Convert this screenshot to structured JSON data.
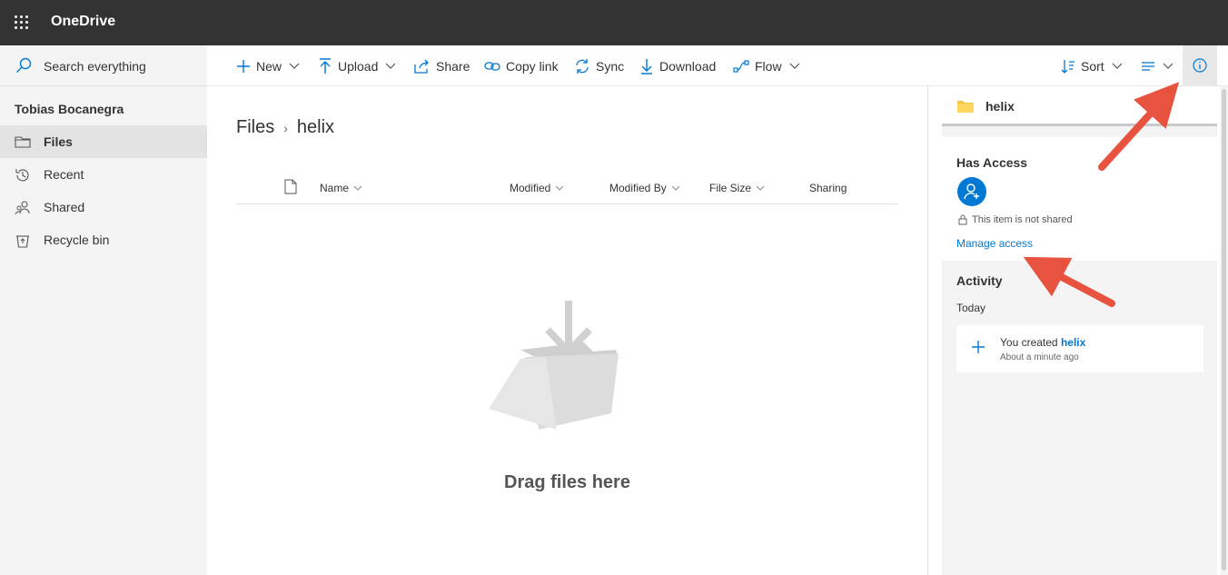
{
  "app": {
    "title": "OneDrive"
  },
  "search": {
    "label": "Search everything"
  },
  "nav": {
    "user": "Tobias Bocanegra",
    "items": [
      {
        "label": "Files",
        "icon": "folder-icon",
        "active": true
      },
      {
        "label": "Recent",
        "icon": "recent-icon"
      },
      {
        "label": "Shared",
        "icon": "shared-icon"
      },
      {
        "label": "Recycle bin",
        "icon": "recycle-bin-icon"
      }
    ]
  },
  "toolbar": {
    "new": "New",
    "upload": "Upload",
    "share": "Share",
    "copy_link": "Copy link",
    "sync": "Sync",
    "download": "Download",
    "flow": "Flow",
    "sort": "Sort"
  },
  "breadcrumb": {
    "root": "Files",
    "current": "helix"
  },
  "columns": {
    "name": "Name",
    "modified": "Modified",
    "modified_by": "Modified By",
    "file_size": "File Size",
    "sharing": "Sharing"
  },
  "empty": {
    "text": "Drag files here"
  },
  "details": {
    "item_name": "helix",
    "has_access": "Has Access",
    "not_shared": "This item is not shared",
    "manage_access": "Manage access",
    "activity": "Activity",
    "today": "Today",
    "activity_prefix": "You created",
    "activity_item": "helix",
    "activity_time": "About a minute ago"
  },
  "colors": {
    "accent": "#0078d4",
    "topbar": "#333333",
    "annotation_arrow": "#e8533f"
  }
}
